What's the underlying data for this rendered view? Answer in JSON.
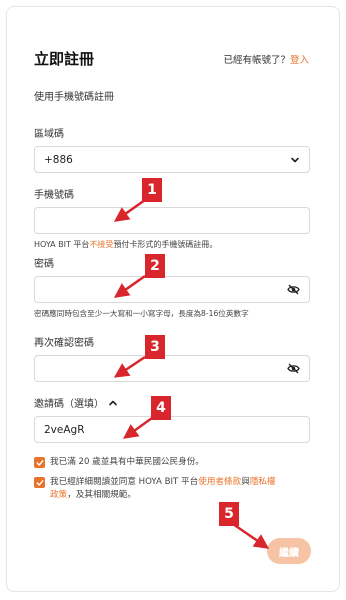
{
  "form": {
    "title": "立即註冊",
    "have_account": "已經有帳號了？",
    "login_link": "登入",
    "subtitle": "使用手機號碼註冊"
  },
  "region": {
    "label": "區域碼",
    "value": "+886"
  },
  "phone": {
    "label": "手機號碼",
    "value": "",
    "hint_prefix": "HOYA BIT 平台",
    "hint_warn": "不接受",
    "hint_suffix": "預付卡形式的手機號碼註冊。"
  },
  "password": {
    "label": "密碼",
    "value": "",
    "hint": "密碼應同時包含至少一大寫和一小寫字母，長度為8-16位英數字"
  },
  "confirm_password": {
    "label": "再次確認密碼",
    "value": ""
  },
  "invite": {
    "label": "邀請碼（選填）",
    "value": "2veAgR"
  },
  "agreements": {
    "age": "我已滿 20 歲並具有中華民國公民身份。",
    "terms_prefix": "我已經詳細閱讀並同意 HOYA BIT 平台",
    "terms_link": "使用者條款",
    "terms_and": "與",
    "privacy_link1": "隱私權",
    "privacy_link2": "政策",
    "terms_suffix": "，及其相關規範。"
  },
  "submit_label": "繼續",
  "annotations": [
    "1",
    "2",
    "3",
    "4",
    "5"
  ],
  "colors": {
    "accent": "#e8732a",
    "button_disabled": "#f6c4a4",
    "annotation": "#d8262c"
  }
}
